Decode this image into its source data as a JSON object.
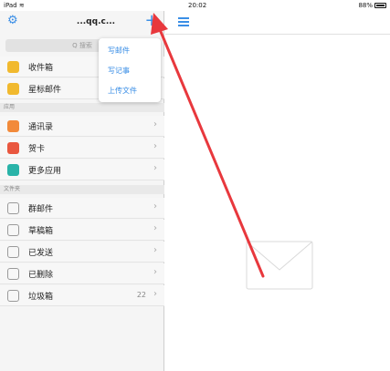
{
  "status_bar": {
    "device": "iPad ",
    "wifi_icon": "wifi-icon",
    "time": "20:02",
    "battery": "88%"
  },
  "sidebar": {
    "account": "...qq.c...",
    "search_placeholder": "Q 搜索",
    "mail_items": [
      {
        "label": "收件箱",
        "icon": "inbox-icon",
        "color": "#f1b92e"
      },
      {
        "label": "星标邮件",
        "icon": "star-icon",
        "color": "#f1b92e"
      }
    ],
    "section_apps": "应用",
    "app_items": [
      {
        "label": "通讯录",
        "icon": "contacts-icon",
        "color": "#f28a3a"
      },
      {
        "label": "贺卡",
        "icon": "card-icon",
        "color": "#e9573f"
      },
      {
        "label": "更多应用",
        "icon": "apps-icon",
        "color": "#29b3a8"
      }
    ],
    "section_folders": "文件夹",
    "folder_items": [
      {
        "label": "群邮件",
        "icon": "group-mail-icon"
      },
      {
        "label": "草稿箱",
        "icon": "drafts-icon"
      },
      {
        "label": "已发送",
        "icon": "sent-icon"
      },
      {
        "label": "已删除",
        "icon": "trash-icon"
      },
      {
        "label": "垃圾箱",
        "icon": "spam-icon",
        "count": "22"
      }
    ]
  },
  "dropdown_menu": {
    "items": [
      "写邮件",
      "写记事",
      "上传文件"
    ]
  },
  "colors": {
    "accent": "#3a8ee6",
    "arrow": "#e8383d"
  }
}
